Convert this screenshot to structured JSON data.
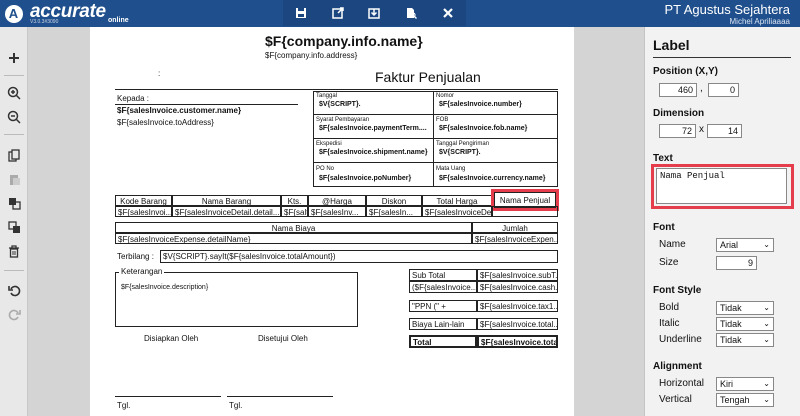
{
  "topbar": {
    "logo_letter": "A",
    "brand": "accurate",
    "brand_sub": "online",
    "version": "V3.0.3#3090",
    "company": "PT Agustus Sejahtera",
    "user": "Michel Apriliaaaa"
  },
  "report": {
    "company_name": "$F{company.info.name}",
    "company_address": "$F{company.info.address}",
    "colon": ":",
    "title": "Faktur Penjualan",
    "kepada_label": "Kepada :",
    "customer_name": "$F{salesInvoice.customer.name}",
    "to_address": "$F{salesInvoice.toAddress}",
    "info": [
      {
        "label": "Tanggal",
        "value": "$V{SCRIPT}."
      },
      {
        "label": "Nomor",
        "value": "$F{salesInvoice.number}"
      },
      {
        "label": "Syarat Pembayaran",
        "value": "$F{salesInvoice.paymentTerm...."
      },
      {
        "label": "FOB",
        "value": "$F{salesInvoice.fob.name}"
      },
      {
        "label": "Ekspedisi",
        "value": "$F{salesInvoice.shipment.name}"
      },
      {
        "label": "Tanggal Pengiriman",
        "value": "$V{SCRIPT}."
      },
      {
        "label": "PO No",
        "value": "$F{salesInvoice.poNumber}"
      },
      {
        "label": "Mata Uang",
        "value": "$F{salesInvoice.currency.name}"
      }
    ],
    "detail_headers": [
      "Kode Barang",
      "Nama Barang",
      "Kts.",
      "@Harga",
      "Diskon",
      "Total Harga",
      "Nama Penjual"
    ],
    "detail_values": [
      "$F{salesInvoi...",
      "$F{salesInvoiceDetail.detail...",
      "$F{salt...",
      "$F{salesInv...",
      "$F{salesIn...",
      "$F{salesInvoiceDe...",
      ""
    ],
    "expense_headers": [
      "Nama Biaya",
      "Jumlah"
    ],
    "expense_values": [
      "$F{salesInvoiceExpense.detailName}",
      "$F{salesInvoiceExpen..."
    ],
    "terbilang_label": "Terbilang :",
    "terbilang_value": "$V{SCRIPT}.sayIt($F{salesInvoice.totalAmount})",
    "keterangan_label": "Keterangan",
    "description": "$F{salesInvoice.description}",
    "totals": [
      {
        "label": "Sub Total",
        "value": "$F{salesInvoice.subT..."
      },
      {
        "label": "($F{salesInvoice...",
        "value": "$F{salesInvoice.cash..."
      },
      {
        "label": "\"PPN (\" +",
        "value": "$F{salesInvoice.tax1..."
      },
      {
        "label": "Biaya Lain-lain",
        "value": "$F{salesInvoice.total..."
      },
      {
        "label": "Total",
        "value": "$F{salesInvoice.tota..."
      }
    ],
    "disiapkan": "Disiapkan Oleh",
    "disetujui": "Disetujui Oleh",
    "tgl1": "Tgl.",
    "tgl2": "Tgl."
  },
  "panel": {
    "title": "Label",
    "position_label": "Position (X,Y)",
    "pos_x": "460",
    "pos_y": "0",
    "dimension_label": "Dimension",
    "dim_w": "72",
    "dim_h": "14",
    "sep_comma": ",",
    "sep_x": "x",
    "text_label": "Text",
    "text_value": "Nama Penjual",
    "font_section": "Font",
    "name_label": "Name",
    "name_value": "Arial",
    "size_label": "Size",
    "size_value": "9",
    "font_style_section": "Font Style",
    "bold_label": "Bold",
    "bold_value": "Tidak",
    "italic_label": "Italic",
    "italic_value": "Tidak",
    "underline_label": "Underline",
    "underline_value": "Tidak",
    "alignment_section": "Alignment",
    "horizontal_label": "Horizontal",
    "horizontal_value": "Kiri",
    "vertical_label": "Vertical",
    "vertical_value": "Tengah"
  },
  "colors": {
    "topbar": "#1f4f8c",
    "selection": "#e53d4b"
  }
}
